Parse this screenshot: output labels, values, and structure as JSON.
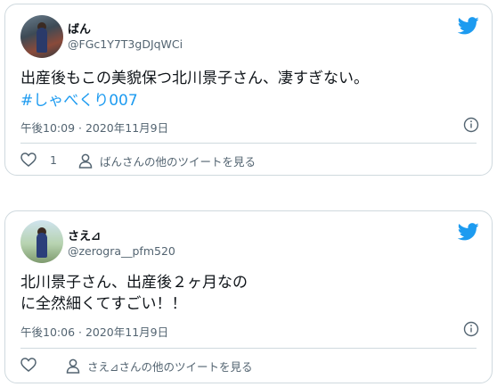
{
  "tweets": [
    {
      "name": "ばん",
      "handle": "@FGc1Y7T3gDJqWCi",
      "text": "出産後もこの美貌保つ北川景子さん、凄すぎない。",
      "hashtag": "#しゃべくり007",
      "time": "午後10:09 · 2020年11月9日",
      "like_count": "1",
      "profile_link": "ばんさんの他のツイートを見る"
    },
    {
      "name": "さえ⊿",
      "handle": "@zerogra__pfm520",
      "text_line1": "北川景子さん、出産後２ヶ月なの",
      "text_line2": "に全然細くてすごい！！",
      "time": "午後10:06 · 2020年11月9日",
      "like_count": "",
      "profile_link": "さえ⊿さんの他のツイートを見る"
    }
  ],
  "colors": {
    "twitter_blue": "#1d9bf0",
    "muted": "#536471",
    "border": "#cfd9de"
  }
}
